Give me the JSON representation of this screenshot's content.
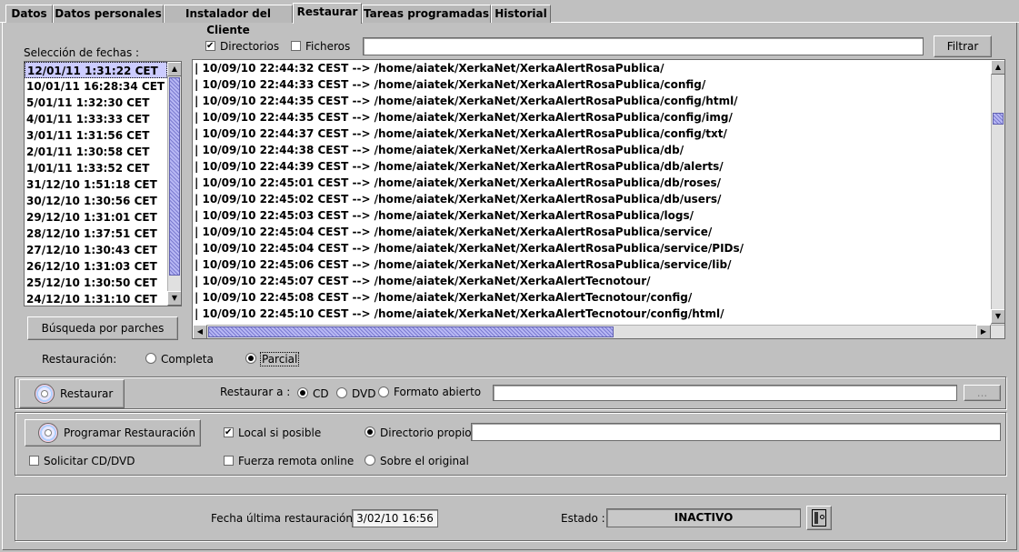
{
  "tabs": [
    "Datos",
    "Datos personales",
    "Instalador del Cliente",
    "Restaurar",
    "Tareas programadas",
    "Historial"
  ],
  "active_tab": "Restaurar",
  "fechas": {
    "label": "Selección de fechas :",
    "items": [
      "12/01/11 1:31:22 CET",
      "10/01/11 16:28:34 CET",
      "5/01/11 1:32:30 CET",
      "4/01/11 1:33:33 CET",
      "3/01/11 1:31:56 CET",
      "2/01/11 1:30:58 CET",
      "1/01/11 1:33:52 CET",
      "31/12/10 1:51:18 CET",
      "30/12/10 1:30:56 CET",
      "29/12/10 1:31:01 CET",
      "28/12/10 1:37:51 CET",
      "27/12/10 1:30:43 CET",
      "26/12/10 1:31:03 CET",
      "25/12/10 1:30:50 CET",
      "24/12/10 1:31:10 CET"
    ],
    "selected_index": 0
  },
  "filter": {
    "directorios_label": "Directorios",
    "directorios_checked": true,
    "ficheros_label": "Ficheros",
    "ficheros_checked": false,
    "input_value": "",
    "button_label": "Filtrar"
  },
  "files": [
    "| 10/09/10 22:44:32 CEST --> /home/aiatek/XerkaNet/XerkaAlertRosaPublica/",
    "| 10/09/10 22:44:33 CEST --> /home/aiatek/XerkaNet/XerkaAlertRosaPublica/config/",
    "| 10/09/10 22:44:35 CEST --> /home/aiatek/XerkaNet/XerkaAlertRosaPublica/config/html/",
    "| 10/09/10 22:44:35 CEST --> /home/aiatek/XerkaNet/XerkaAlertRosaPublica/config/img/",
    "| 10/09/10 22:44:37 CEST --> /home/aiatek/XerkaNet/XerkaAlertRosaPublica/config/txt/",
    "| 10/09/10 22:44:38 CEST --> /home/aiatek/XerkaNet/XerkaAlertRosaPublica/db/",
    "| 10/09/10 22:44:39 CEST --> /home/aiatek/XerkaNet/XerkaAlertRosaPublica/db/alerts/",
    "| 10/09/10 22:45:01 CEST --> /home/aiatek/XerkaNet/XerkaAlertRosaPublica/db/roses/",
    "| 10/09/10 22:45:02 CEST --> /home/aiatek/XerkaNet/XerkaAlertRosaPublica/db/users/",
    "| 10/09/10 22:45:03 CEST --> /home/aiatek/XerkaNet/XerkaAlertRosaPublica/logs/",
    "| 10/09/10 22:45:04 CEST --> /home/aiatek/XerkaNet/XerkaAlertRosaPublica/service/",
    "| 10/09/10 22:45:04 CEST --> /home/aiatek/XerkaNet/XerkaAlertRosaPublica/service/PIDs/",
    "| 10/09/10 22:45:06 CEST --> /home/aiatek/XerkaNet/XerkaAlertRosaPublica/service/lib/",
    "| 10/09/10 22:45:07 CEST --> /home/aiatek/XerkaNet/XerkaAlertTecnotour/",
    "| 10/09/10 22:45:08 CEST --> /home/aiatek/XerkaNet/XerkaAlertTecnotour/config/",
    "| 10/09/10 22:45:10 CEST --> /home/aiatek/XerkaNet/XerkaAlertTecnotour/config/html/"
  ],
  "busqueda_label": "Búsqueda por parches",
  "restauracion": {
    "label": "Restauración:",
    "completa_label": "Completa",
    "parcial_label": "Parcial",
    "selected": "Parcial"
  },
  "restaurar_panel": {
    "button_label": "Restaurar",
    "restaurar_a_label": "Restaurar a :",
    "cd_label": "CD",
    "dvd_label": "DVD",
    "formato_label": "Formato abierto",
    "selected": "CD",
    "path_value": "",
    "browse_label": "..."
  },
  "programar_panel": {
    "button_label": "Programar Restauración",
    "local_label": "Local si posible",
    "local_checked": true,
    "fuerza_label": "Fuerza remota online",
    "fuerza_checked": false,
    "solicitar_label": "Solicitar CD/DVD",
    "solicitar_checked": false,
    "dir_propio_label": "Directorio propio",
    "sobre_original_label": "Sobre el original",
    "selected": "Directorio propio",
    "dir_value": ""
  },
  "status_panel": {
    "fecha_label": "Fecha última restauración :",
    "fecha_value": "3/02/10 16:56",
    "estado_label": "Estado :",
    "estado_value": "INACTIVO"
  }
}
